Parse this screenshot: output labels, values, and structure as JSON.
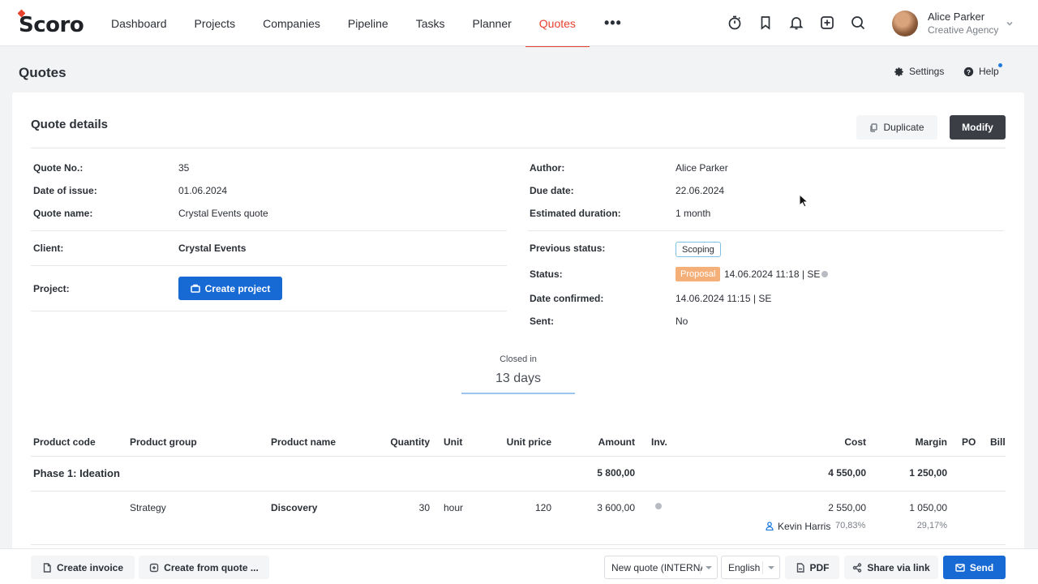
{
  "app": {
    "logo_text": "Scoro"
  },
  "nav": {
    "items": [
      {
        "label": "Dashboard"
      },
      {
        "label": "Projects"
      },
      {
        "label": "Companies"
      },
      {
        "label": "Pipeline"
      },
      {
        "label": "Tasks"
      },
      {
        "label": "Planner"
      },
      {
        "label": "Quotes",
        "active": true
      }
    ],
    "more_label": "•••"
  },
  "top_icons": [
    "timer-icon",
    "bookmark-icon",
    "bell-icon",
    "add-square-icon",
    "search-icon"
  ],
  "user": {
    "name": "Alice Parker",
    "org": "Creative Agency"
  },
  "page": {
    "title": "Quotes",
    "settings_label": "Settings",
    "help_label": "Help"
  },
  "quote": {
    "card_title": "Quote details",
    "duplicate_label": "Duplicate",
    "modify_label": "Modify",
    "left": {
      "quote_no_label": "Quote No.:",
      "quote_no": "35",
      "date_issue_label": "Date of issue:",
      "date_issue": "01.06.2024",
      "quote_name_label": "Quote name:",
      "quote_name": "Crystal Events quote",
      "client_label": "Client:",
      "client": "Crystal Events",
      "project_label": "Project:",
      "create_project_label": "Create project"
    },
    "right": {
      "author_label": "Author:",
      "author": "Alice Parker",
      "due_label": "Due date:",
      "due": "22.06.2024",
      "duration_label": "Estimated duration:",
      "duration": "1 month",
      "prev_status_label": "Previous status:",
      "prev_status": "Scoping",
      "status_label": "Status:",
      "status": "Proposal",
      "status_meta": "14.06.2024 11:18 | SE",
      "confirmed_label": "Date confirmed:",
      "confirmed": "14.06.2024 11:15 | SE",
      "sent_label": "Sent:",
      "sent": "No"
    },
    "closed": {
      "label": "Closed in",
      "value": "13 days"
    }
  },
  "colors": {
    "accent": "#e8412e",
    "primary": "#1769d4",
    "proposal": "#f5b07a",
    "dark_button": "#3b3f45"
  },
  "table": {
    "headers": {
      "code": "Product code",
      "group": "Product group",
      "name": "Product name",
      "qty": "Quantity",
      "unit": "Unit",
      "price": "Unit price",
      "amount": "Amount",
      "inv": "Inv.",
      "cost": "Cost",
      "margin": "Margin",
      "po": "PO",
      "bill": "Bill"
    },
    "phase": {
      "title": "Phase 1: Ideation",
      "amount": "5 800,00",
      "cost": "4 550,00",
      "margin": "1 250,00"
    },
    "row": {
      "group": "Strategy",
      "name": "Discovery",
      "qty": "30",
      "unit": "hour",
      "price": "120",
      "amount": "3 600,00",
      "cost": "2 550,00",
      "margin": "1 050,00",
      "person": "Kevin Harris",
      "cost_pct": "70,83%",
      "margin_pct": "29,17%"
    }
  },
  "bottom": {
    "create_invoice": "Create invoice",
    "create_from_quote": "Create from quote ...",
    "template_select": "New quote (INTERNAL)",
    "language_select": "English",
    "pdf": "PDF",
    "share": "Share via link",
    "send": "Send"
  }
}
